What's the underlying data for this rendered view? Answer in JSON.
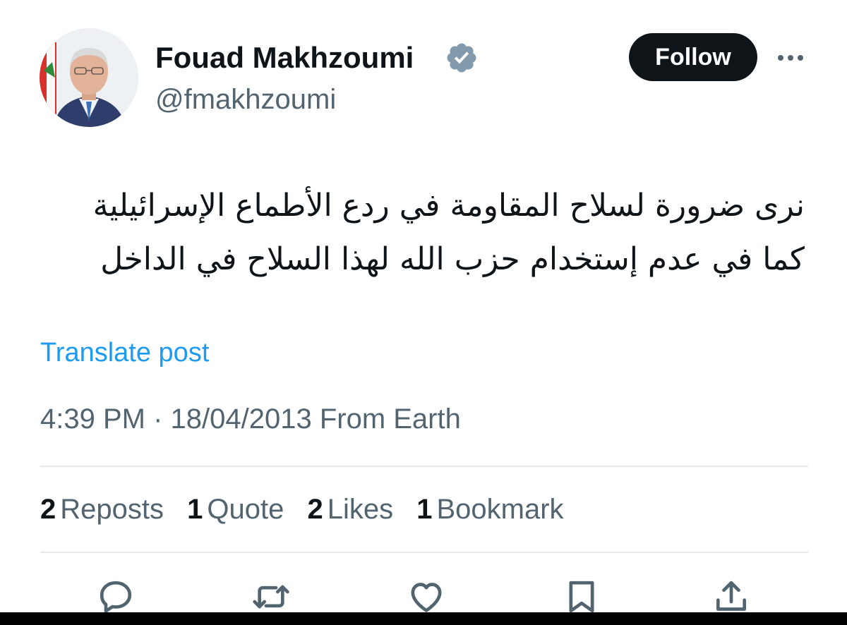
{
  "author": {
    "display_name": "Fouad Makhzoumi",
    "handle": "@fmakhzoumi",
    "verified": true,
    "avatar": "profile-photo"
  },
  "follow_button": {
    "label": "Follow"
  },
  "more_button": {
    "icon": "more-icon"
  },
  "post": {
    "text_line_1": "نرى ضرورة لسلاح المقاومة في ردع الأطماع الإسرائيلية",
    "text_line_2": "كما في عدم إستخدام  حزب الله لهذا السلاح في الداخل",
    "translate_label": "Translate post",
    "meta": "4:39 PM · 18/04/2013 From Earth"
  },
  "stats": [
    {
      "count": "2",
      "label": "Reposts"
    },
    {
      "count": "1",
      "label": "Quote"
    },
    {
      "count": "2",
      "label": "Likes"
    },
    {
      "count": "1",
      "label": "Bookmark"
    }
  ],
  "actions": [
    {
      "icon": "reply-icon"
    },
    {
      "icon": "repost-icon"
    },
    {
      "icon": "like-icon"
    },
    {
      "icon": "bookmark-icon"
    },
    {
      "icon": "share-icon"
    }
  ],
  "colors": {
    "text_primary": "#0f1419",
    "text_secondary": "#536471",
    "link": "#1d9bf0",
    "verified_badge": "#829aab",
    "follow_bg": "#0f1419"
  }
}
